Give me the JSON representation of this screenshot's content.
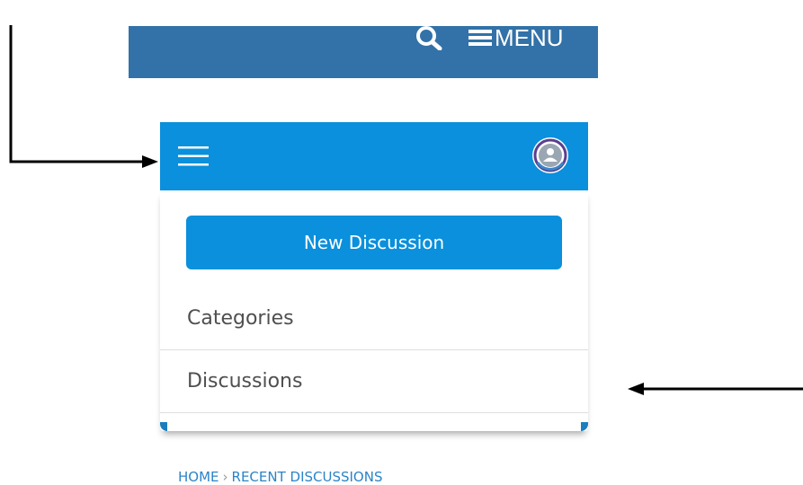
{
  "site_header": {
    "menu_label": "MENU",
    "icons": [
      "search-icon",
      "menu-icon"
    ],
    "background": "#3272a8"
  },
  "app_bar": {
    "background": "#0a90dc",
    "icons": [
      "hamburger-icon",
      "avatar-icon"
    ]
  },
  "panel": {
    "new_discussion_label": "New Discussion",
    "nav_items": [
      {
        "label": "Categories"
      },
      {
        "label": "Discussions"
      }
    ]
  },
  "breadcrumb": {
    "home": "HOME",
    "separator": "›",
    "current": "RECENT DISCUSSIONS"
  },
  "colors": {
    "accent": "#0a90dc",
    "header": "#3272a8",
    "link": "#2b84c8"
  }
}
